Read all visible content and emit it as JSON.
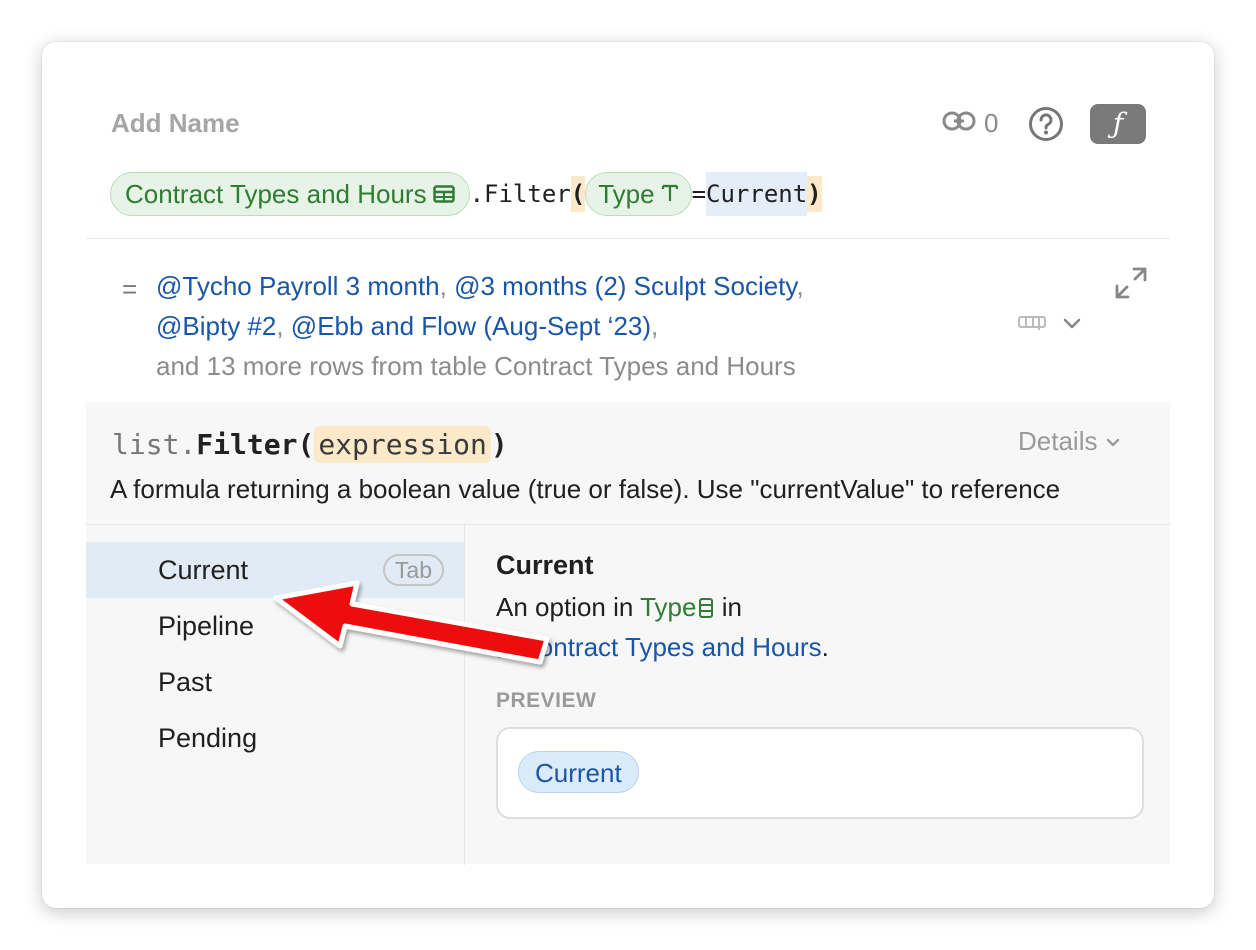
{
  "header": {
    "add_name": "Add Name",
    "link_count": "0",
    "fx_label": "ƒ"
  },
  "formula": {
    "table_chip": "Contract Types and Hours",
    "filter_method": ".Filter",
    "open_paren": "(",
    "column_chip": "Type",
    "equals": "=",
    "value": "Current",
    "close_paren": ")"
  },
  "result": {
    "equals_sign": "=",
    "item1": "@Tycho Payroll 3 month",
    "sep1": ", ",
    "item2": "@3 months (2) Sculpt Society",
    "sep2": ",",
    "item3": "@Bipty #2",
    "sep3": ", ",
    "item4": "@Ebb and Flow (Aug-Sept ‘23)",
    "sep4": ",",
    "more": "and 13 more rows from table Contract Types and Hours"
  },
  "doc": {
    "sig_prefix": "list.",
    "sig_name": "Filter(",
    "sig_arg": "expression",
    "sig_close": ")",
    "details_label": "Details",
    "description": "A formula returning a boolean value (true or false). Use \"currentValue\" to reference"
  },
  "suggestions": {
    "items": [
      {
        "label": "Current",
        "selected": true
      },
      {
        "label": "Pipeline",
        "selected": false
      },
      {
        "label": "Past",
        "selected": false
      },
      {
        "label": "Pending",
        "selected": false
      }
    ],
    "tab_hint": "Tab"
  },
  "detail": {
    "title": "Current",
    "desc_prefix": "An option in ",
    "column": "Type",
    "desc_in": " in",
    "table": "Contract Types and Hours",
    "period": ".",
    "preview_label": "PREVIEW",
    "preview_value": "Current"
  },
  "colors": {
    "accent_blue": "#1a56a8",
    "chip_green": "#2e7d32",
    "selected_row": "#e1ebf5",
    "annotation_arrow": "#ee1111"
  }
}
